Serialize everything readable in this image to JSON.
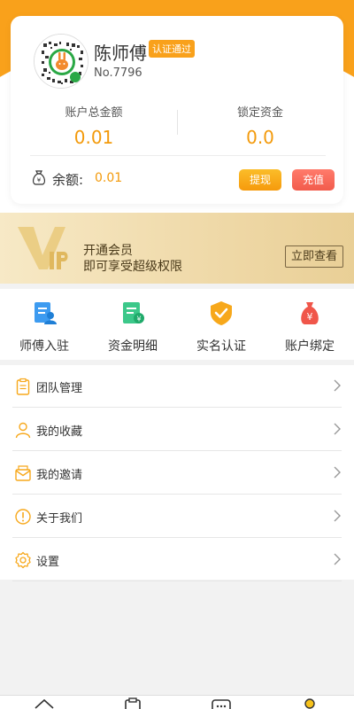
{
  "profile": {
    "name": "陈师傅",
    "badge": "认证通过",
    "number": "No.7796"
  },
  "stats": {
    "total_label": "账户总金额",
    "total_value": "0.01",
    "locked_label": "锁定资金",
    "locked_value": "0.0"
  },
  "balance": {
    "label": "余额:",
    "value": "0.01",
    "withdraw_label": "提现",
    "recharge_label": "充值"
  },
  "vip": {
    "line1": "开通会员",
    "line2": "即可享受超级权限",
    "button": "立即查看"
  },
  "grid": [
    {
      "label": "师傅入驻",
      "icon": "worker-register-icon"
    },
    {
      "label": "资金明细",
      "icon": "fund-detail-icon"
    },
    {
      "label": "实名认证",
      "icon": "verify-shield-icon"
    },
    {
      "label": "账户绑定",
      "icon": "money-bag-icon"
    }
  ],
  "menu": [
    {
      "label": "团队管理",
      "icon": "clipboard-icon"
    },
    {
      "label": "我的收藏",
      "icon": "user-icon"
    },
    {
      "label": "我的邀请",
      "icon": "mail-icon"
    },
    {
      "label": "关于我们",
      "icon": "info-icon"
    },
    {
      "label": "设置",
      "icon": "gear-icon"
    }
  ],
  "colors": {
    "brand_orange": "#f9a11b",
    "value_orange": "#f39a0b",
    "recharge_red": "#f25b4c"
  }
}
